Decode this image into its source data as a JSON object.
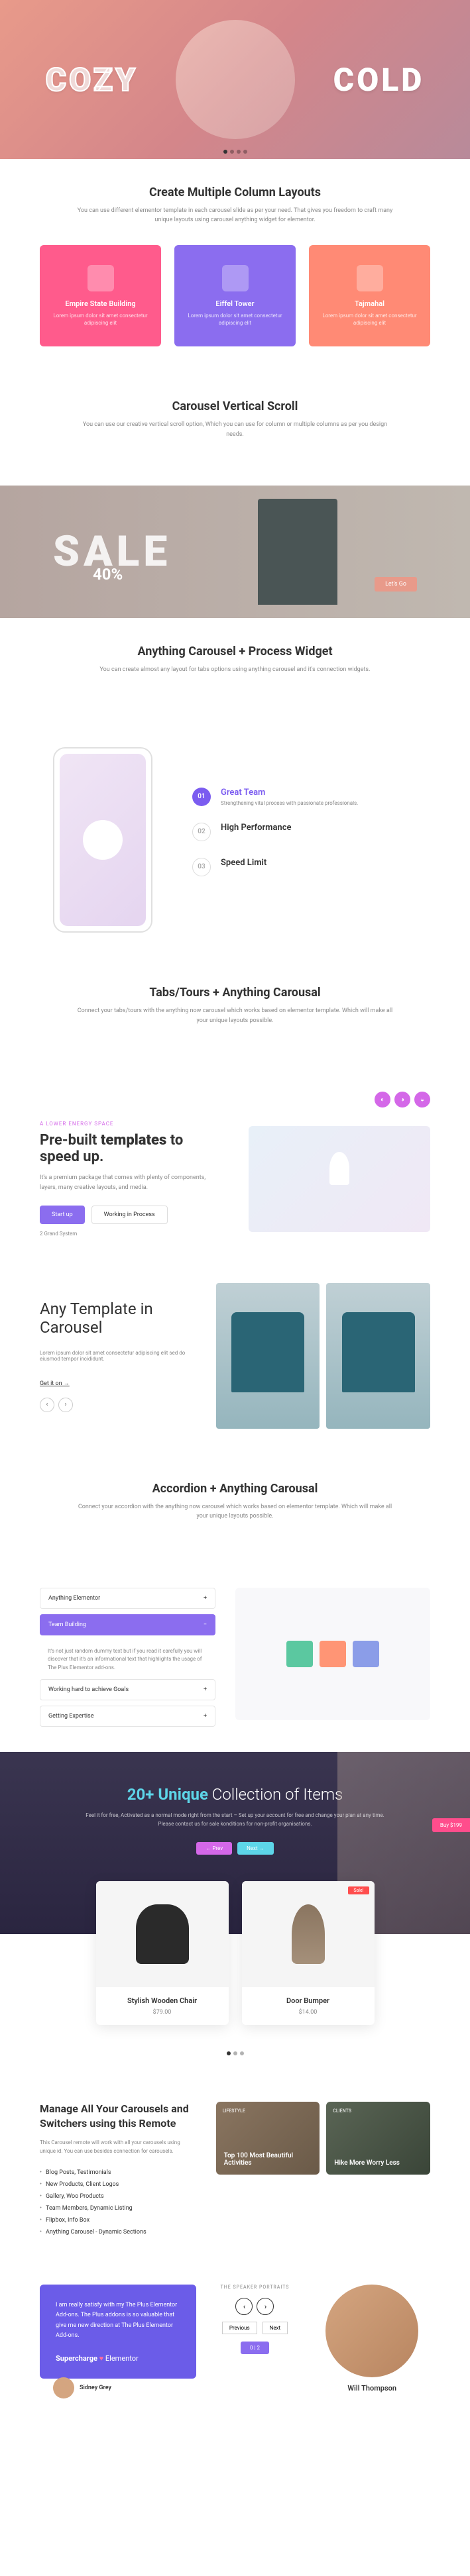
{
  "hero": {
    "left": "COZY",
    "right": "COLD"
  },
  "columns": {
    "title": "Create Multiple Column Layouts",
    "desc": "You can use different elementor template in each carousel slide as per your need. That gives you freedom to craft many unique layouts using carousel anything widget for elementor.",
    "cards": [
      {
        "title": "Empire State Building",
        "text": "Lorem ipsum dolor sit amet consectetur adipiscing elit"
      },
      {
        "title": "Eiffel Tower",
        "text": "Lorem ipsum dolor sit amet consectetur adipiscing elit"
      },
      {
        "title": "Tajmahal",
        "text": "Lorem ipsum dolor sit amet consectetur adipiscing elit"
      }
    ]
  },
  "vertical": {
    "title": "Carousel Vertical Scroll",
    "desc": "You can use our creative vertical scroll option, Which you can use for column or multiple columns as per you design needs."
  },
  "sale": {
    "text": "SALE",
    "percent": "40%",
    "btn": "Let's Go"
  },
  "process": {
    "title": "Anything Carousel + Process Widget",
    "desc": "You can create almost any layout for tabs options using anything carousel and it's connection widgets.",
    "items": [
      {
        "num": "01",
        "title": "Great Team",
        "desc": "Strengthening vital process with passionate professionals."
      },
      {
        "num": "02",
        "title": "High Performance",
        "desc": ""
      },
      {
        "num": "03",
        "title": "Speed Limit",
        "desc": ""
      }
    ]
  },
  "tabs": {
    "title": "Tabs/Tours + Anything Carousal",
    "desc": "Connect your tabs/tours with the anything now carousel which works based on elementor template. Which will make all your unique layouts possible.",
    "label": "A LOWER ENERGY SPACE",
    "heading_pre": "Pre-built",
    "heading_strong": "templates",
    "heading_post": " to speed up.",
    "content": "It's a premium package that comes with plenty of components, layers, many creative layouts, and media.",
    "btn1": "Start up",
    "btn2": "Working in Process",
    "grand": "2 Grand System"
  },
  "template": {
    "title": "Any Template in Carousel",
    "desc": "Lorem ipsum dolor sit amet consectetur adipiscing elit sed do eiusmod tempor incididunt.",
    "link": "Get it on →"
  },
  "accordion": {
    "title": "Accordion + Anything Carousal",
    "desc": "Connect your accordion with the anything now carousel which works based on elementor template. Which will make all your unique layouts possible.",
    "items": [
      "Anything Elementor",
      "Team Building",
      "Working hard to achieve Goals",
      "Getting Expertise"
    ],
    "expanded": "It's not just random dummy text but if you read it carefully you will discover that it's an informational text that highlights the usage of The Plus Elementor add-ons."
  },
  "unique": {
    "title_pre": "",
    "title_strong": "20+ Unique",
    "title_post": " Collection of Items",
    "desc": "Feel it for free, Activated as a normal mode right from the start – Set up your account for free and change your plan at any time. Please contact us for sale konditions for non-profit organisations.",
    "prev": "← Prev",
    "next": "Next →",
    "buy": "Buy $199"
  },
  "products": [
    {
      "name": "Stylish Wooden Chair",
      "price": "$79.00",
      "sale": ""
    },
    {
      "name": "Door Bumper",
      "price": "$14.00",
      "sale": "Sale!"
    }
  ],
  "remote": {
    "title": "Manage All Your Carousels and Switchers using this Remote",
    "desc": "This Carousel remote will work with all your carousels using unique id. You can use besides connection for carousels.",
    "items": [
      "Blog Posts, Testimonials",
      "New Products, Client Logos",
      "Gallery, Woo Products",
      "Team Members, Dynamic Listing",
      "Flipbox, Info Box",
      "Anything Carousel - Dynamic Sections"
    ],
    "grid": [
      {
        "cat": "LIFESTYLE",
        "title": "Top 100 Most Beautiful Activities"
      },
      {
        "cat": "CLIENTS",
        "title": "Hike More Worry Less"
      }
    ]
  },
  "testimonial": {
    "text": "I am really satisfy with my The Plus Elementor Add-ons. The Plus addons is so valuable that give me new direction at The Plus Elementor Add-ons.",
    "supercharge": "Supercharge",
    "elementor": "Elementor",
    "author": "Sidney Grey",
    "center_label": "THE SPEAKER PORTRAITS",
    "prev": "Previous",
    "next": "Next",
    "page": "0 | 2",
    "right_name": "Will Thompson"
  }
}
